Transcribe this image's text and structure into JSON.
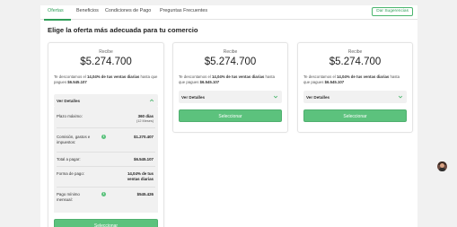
{
  "tabs": [
    {
      "label": "Ofertas",
      "active": true
    },
    {
      "label": "Beneficios",
      "active": false
    },
    {
      "label": "Condiciones de Pago",
      "active": false
    },
    {
      "label": "Preguntas Frecuentes",
      "active": false
    }
  ],
  "suggestions_button": "Dar Sugerencias",
  "heading": "Elige la oferta más adecuada para tu comercio",
  "offers": [
    {
      "recibe": "Recibe",
      "amount": "$5.274.700",
      "desc_pre": "Te descontamos el ",
      "desc_pct": "14,04% de tus ventas diarias",
      "desc_mid": " hasta que pagues ",
      "desc_total": "$6.545.107",
      "details_label": "Ver Detalles",
      "expanded": true,
      "details": [
        {
          "key": "Plazo máximo:",
          "value": "360 días",
          "sub": "(12 Meses)",
          "info": false
        },
        {
          "key": "Comisión, gastos e impuestos:",
          "value": "$1.270.407",
          "sub": "",
          "info": true
        },
        {
          "key": "Total a pagar:",
          "value": "$6.545.107",
          "sub": "",
          "info": false
        },
        {
          "key": "Forma de pago:",
          "value": "14,04% de tus ventas diarias",
          "sub": "",
          "info": false
        },
        {
          "key": "Pago mínimo mensual:",
          "value": "$545.426",
          "sub": "",
          "info": true
        }
      ],
      "select_label": "Seleccionar"
    },
    {
      "recibe": "Recibe",
      "amount": "$5.274.700",
      "desc_pre": "Te descontamos el ",
      "desc_pct": "14,04% de tus ventas diarias",
      "desc_mid": " hasta que pagues ",
      "desc_total": "$6.545.107",
      "details_label": "Ver Detalles",
      "expanded": false,
      "select_label": "Seleccionar"
    },
    {
      "recibe": "Recibe",
      "amount": "$5.274.700",
      "desc_pre": "Te descontamos el ",
      "desc_pct": "14,04% de tus ventas diarias",
      "desc_mid": " hasta que pagues ",
      "desc_total": "$6.545.107",
      "details_label": "Ver Detalles",
      "expanded": false,
      "select_label": "Seleccionar"
    }
  ],
  "colors": {
    "accent": "#5cc27d",
    "accent_text": "#2f9e58",
    "panel": "#f1f1f1"
  },
  "icons": {
    "expanded": "chevron-up-icon",
    "collapsed": "chevron-down-icon",
    "info": "info-icon",
    "avatar": "user-avatar"
  }
}
